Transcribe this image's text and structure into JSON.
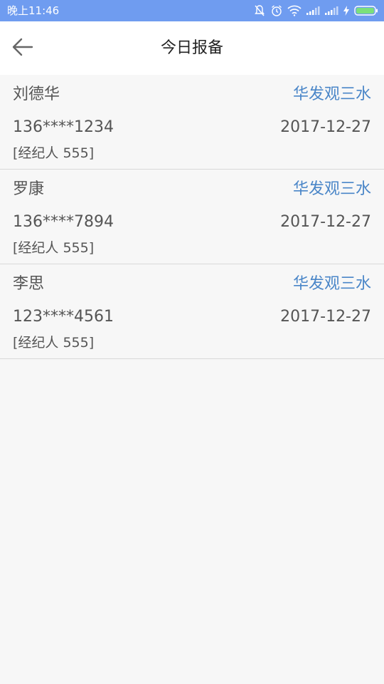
{
  "status_bar": {
    "time": "晚上11:46",
    "icons": [
      "mute-icon",
      "alarm-icon",
      "wifi-icon",
      "signal-icon",
      "signal-icon",
      "charging-icon",
      "battery-icon"
    ],
    "color": "#6f9cf0"
  },
  "header": {
    "title": "今日报备",
    "back_icon": "arrow-left-icon"
  },
  "records": [
    {
      "name": "刘德华",
      "project": "华发观三水",
      "phone": "136****1234",
      "date": "2017-12-27",
      "agent": "[经纪人 555]"
    },
    {
      "name": "罗康",
      "project": "华发观三水",
      "phone": "136****7894",
      "date": "2017-12-27",
      "agent": "[经纪人 555]"
    },
    {
      "name": "李思",
      "project": "华发观三水",
      "phone": "123****4561",
      "date": "2017-12-27",
      "agent": "[经纪人 555]"
    }
  ],
  "colors": {
    "accent": "#4a86c8",
    "text": "#555555",
    "background": "#f7f7f7"
  }
}
